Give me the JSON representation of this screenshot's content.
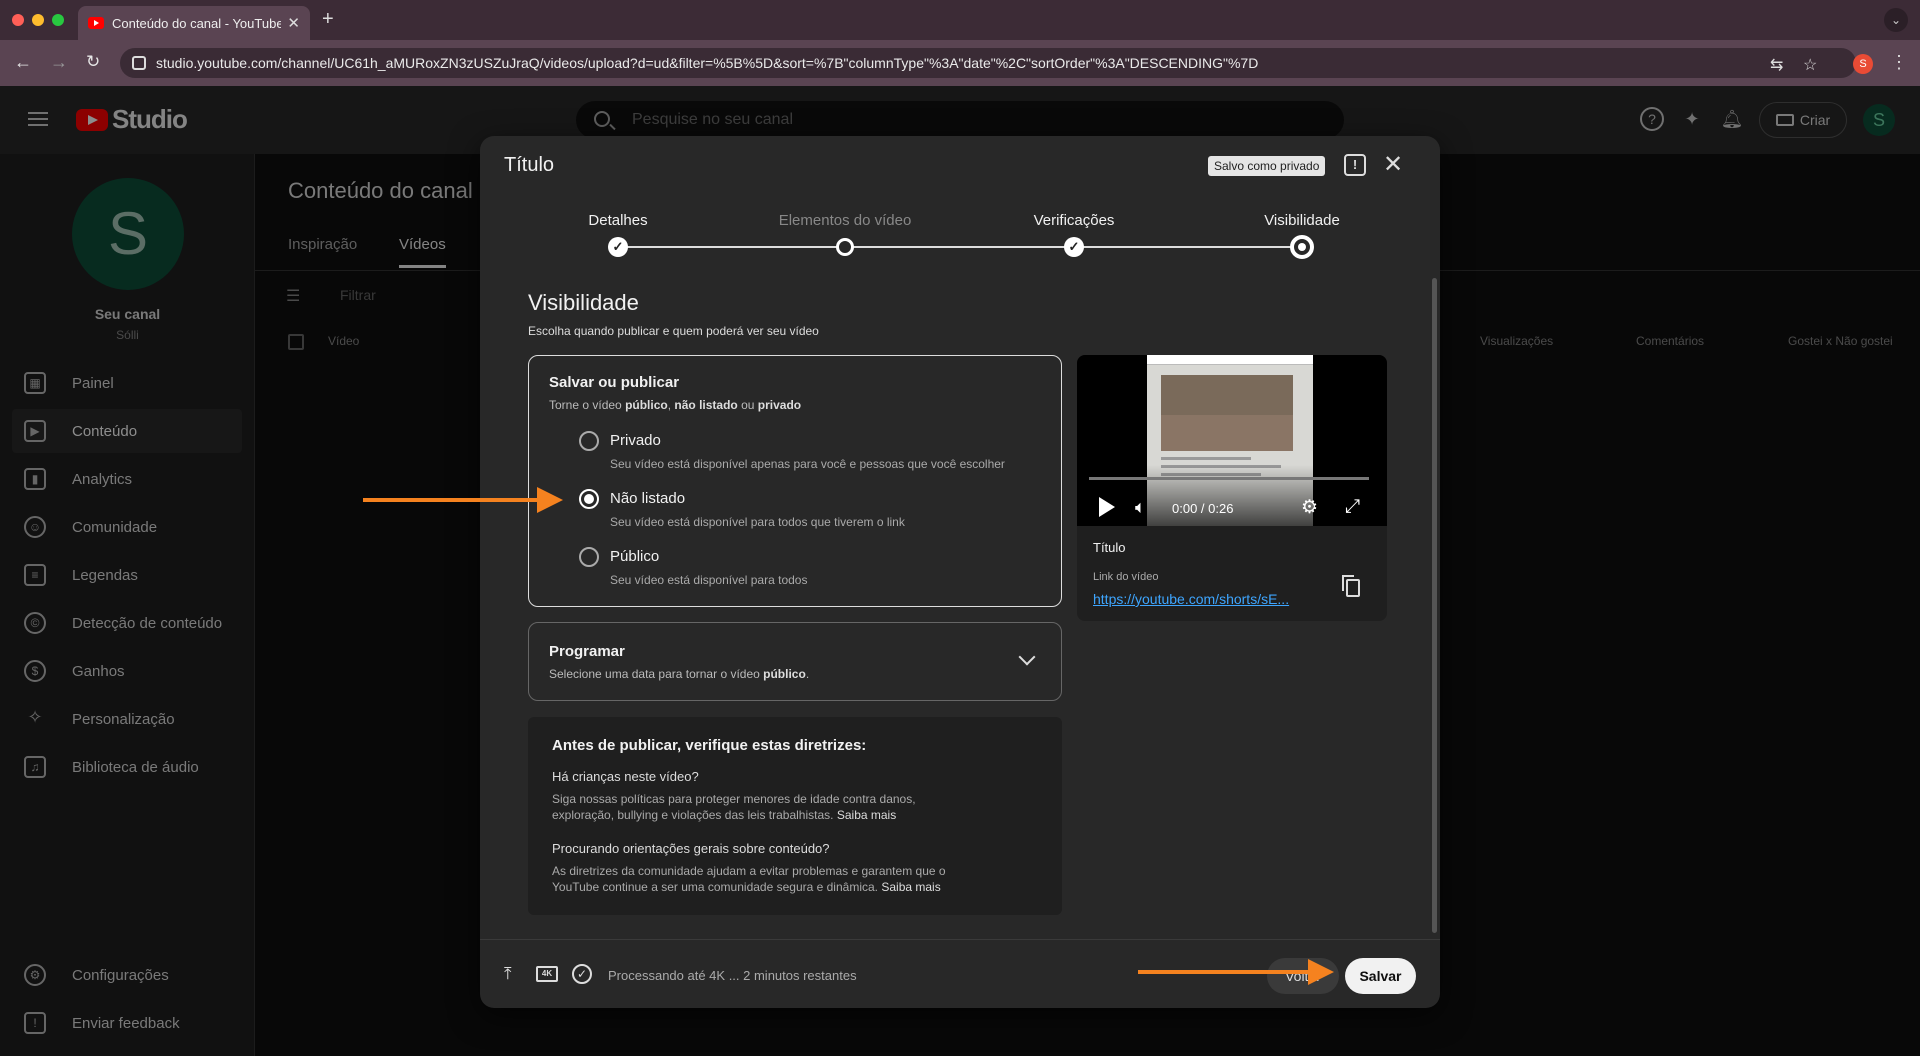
{
  "browser": {
    "tab_title": "Conteúdo do canal - YouTube Studio",
    "url": "studio.youtube.com/channel/UC61h_aMURoxZN3zUSZuJraQ/videos/upload?d=ud&filter=%5B%5D&sort=%7B\"columnType\"%3A\"date\"%2C\"sortOrder\"%3A\"DESCENDING\"%7D",
    "profile_initial": "S"
  },
  "header": {
    "logo_text": "Studio",
    "search_placeholder": "Pesquise no seu canal",
    "create_label": "Criar",
    "avatar_initial": "S"
  },
  "sidebar": {
    "avatar_initial": "S",
    "channel_name": "Seu canal",
    "channel_sub": "Sólli",
    "items": [
      {
        "label": "Painel",
        "icon": "dashboard-icon"
      },
      {
        "label": "Conteúdo",
        "icon": "content-icon",
        "active": true
      },
      {
        "label": "Analytics",
        "icon": "analytics-icon"
      },
      {
        "label": "Comunidade",
        "icon": "community-icon"
      },
      {
        "label": "Legendas",
        "icon": "subtitles-icon"
      },
      {
        "label": "Detecção de conteúdo",
        "icon": "copyright-icon"
      },
      {
        "label": "Ganhos",
        "icon": "dollar-icon"
      },
      {
        "label": "Personalização",
        "icon": "magic-wand-icon"
      },
      {
        "label": "Biblioteca de áudio",
        "icon": "audio-library-icon"
      }
    ],
    "settings_label": "Configurações",
    "feedback_label": "Enviar feedback"
  },
  "page": {
    "title": "Conteúdo do canal",
    "tabs": [
      "Inspiração",
      "Vídeos"
    ],
    "filter_placeholder": "Filtrar",
    "columns": [
      "Vídeo",
      "Visualizações",
      "Comentários",
      "Gostei x Não gostei"
    ]
  },
  "dialog": {
    "title": "Título",
    "saved_badge": "Salvo como privado",
    "steps": [
      "Detalhes",
      "Elementos do vídeo",
      "Verificações",
      "Visibilidade"
    ],
    "visibility_heading": "Visibilidade",
    "visibility_sub": "Escolha quando publicar e quem poderá ver seu vídeo",
    "save_publish": {
      "title": "Salvar ou publicar",
      "sub_prefix": "Torne o vídeo ",
      "sub_public": "público",
      "sub_sep1": ", ",
      "sub_unlisted": "não listado",
      "sub_sep2": " ou ",
      "sub_private": "privado",
      "options": [
        {
          "label": "Privado",
          "desc": "Seu vídeo está disponível apenas para você e pessoas que você escolher",
          "selected": false
        },
        {
          "label": "Não listado",
          "desc": "Seu vídeo está disponível para todos que tiverem o link",
          "selected": true
        },
        {
          "label": "Público",
          "desc": "Seu vídeo está disponível para todos",
          "selected": false
        }
      ]
    },
    "schedule": {
      "title": "Programar",
      "sub_prefix": "Selecione uma data para tornar o vídeo ",
      "sub_bold": "público",
      "sub_suffix": "."
    },
    "guidelines": {
      "title": "Antes de publicar, verifique estas diretrizes:",
      "q1": "Há crianças neste vídeo?",
      "p1": "Siga nossas políticas para proteger menores de idade contra danos, exploração, bullying e violações das leis trabalhistas.",
      "q2": "Procurando orientações gerais sobre conteúdo?",
      "p2": "As diretrizes da comunidade ajudam a evitar problemas e garantem que o YouTube continue a ser uma comunidade segura e dinâmica.",
      "learn_more": "Saiba mais"
    },
    "preview": {
      "time": "0:00 / 0:26",
      "title": "Título",
      "link_label": "Link do vídeo",
      "link_url": "https://youtube.com/shorts/sE..."
    },
    "footer": {
      "processing": "Processando até 4K ... 2 minutos restantes",
      "back_label": "Voltar",
      "save_label": "Salvar",
      "quality_badge": "4K"
    }
  },
  "colors": {
    "accent_arrow": "#f5821f",
    "link": "#3ea6ff",
    "brand": "#ff0000"
  }
}
